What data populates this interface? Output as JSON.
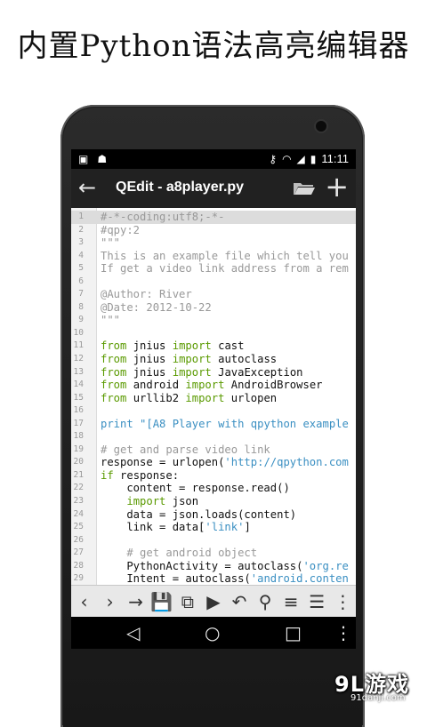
{
  "promo": {
    "title": "内置Python语法高亮编辑器"
  },
  "status_bar": {
    "time": "11:11"
  },
  "action_bar": {
    "title": "QEdit - a8player.py"
  },
  "editor": {
    "lines": [
      {
        "n": "1",
        "html": "<span class='cm'>#-*-coding:utf8;-*-</span>"
      },
      {
        "n": "2",
        "html": "<span class='cm'>#qpy:2</span>"
      },
      {
        "n": "3",
        "html": "<span class='cm'>\"\"\"</span>"
      },
      {
        "n": "4",
        "html": "<span class='cm'>This is an example file which tell you</span>"
      },
      {
        "n": "5",
        "html": "<span class='cm'>If get a video link address from a rem</span>"
      },
      {
        "n": "6",
        "html": ""
      },
      {
        "n": "7",
        "html": "<span class='cm'>@Author: River</span>"
      },
      {
        "n": "8",
        "html": "<span class='cm'>@Date: 2012-10-22</span>"
      },
      {
        "n": "9",
        "html": "<span class='cm'>\"\"\"</span>"
      },
      {
        "n": "10",
        "html": ""
      },
      {
        "n": "11",
        "html": "<span class='kw'>from</span> jnius <span class='kw'>import</span> cast"
      },
      {
        "n": "12",
        "html": "<span class='kw'>from</span> jnius <span class='kw'>import</span> autoclass"
      },
      {
        "n": "13",
        "html": "<span class='kw'>from</span> jnius <span class='kw'>import</span> JavaException"
      },
      {
        "n": "14",
        "html": "<span class='kw'>from</span> android <span class='kw'>import</span> AndroidBrowser"
      },
      {
        "n": "15",
        "html": "<span class='kw'>from</span> urllib2 <span class='kw'>import</span> urlopen"
      },
      {
        "n": "16",
        "html": ""
      },
      {
        "n": "17",
        "html": "<span class='pr'>print</span> <span class='str'>\"[A8 Player with qpython example</span>"
      },
      {
        "n": "18",
        "html": ""
      },
      {
        "n": "19",
        "html": "<span class='cm'># get and parse video link</span>"
      },
      {
        "n": "20",
        "html": "response = urlopen(<span class='str'>'http://qpython.com</span>"
      },
      {
        "n": "21",
        "html": "<span class='kw'>if</span> response:"
      },
      {
        "n": "22",
        "html": "    content = response.read()"
      },
      {
        "n": "23",
        "html": "    <span class='kw'>import</span> json"
      },
      {
        "n": "24",
        "html": "    data = json.loads(content)"
      },
      {
        "n": "25",
        "html": "    link = data[<span class='str'>'link'</span>]"
      },
      {
        "n": "26",
        "html": ""
      },
      {
        "n": "27",
        "html": "    <span class='cm'># get android object</span>"
      },
      {
        "n": "28",
        "html": "    PythonActivity = autoclass(<span class='str'>'org.re</span>"
      },
      {
        "n": "29",
        "html": "    Intent = autoclass(<span class='str'>'android.conten</span>"
      }
    ]
  },
  "toolbar": {
    "items": [
      {
        "name": "undo-nav-left-icon",
        "glyph": "‹"
      },
      {
        "name": "nav-right-icon",
        "glyph": "›"
      },
      {
        "name": "goto-arrow-icon",
        "glyph": "→"
      },
      {
        "name": "save-icon",
        "glyph": "💾"
      },
      {
        "name": "save-as-icon",
        "glyph": "⧉"
      },
      {
        "name": "run-icon",
        "glyph": "▶"
      },
      {
        "name": "undo-icon",
        "glyph": "↶"
      },
      {
        "name": "search-icon",
        "glyph": "⚲"
      },
      {
        "name": "indent-icon",
        "glyph": "≡"
      },
      {
        "name": "snippets-icon",
        "glyph": "☰"
      },
      {
        "name": "more-icon",
        "glyph": "⋮"
      }
    ]
  },
  "watermark": {
    "brand": "9L游戏",
    "site": "91danji.com"
  },
  "colors": {
    "keyword": "#5a9a00",
    "string": "#3a8fc2",
    "comment": "#999999",
    "actionbar": "#212121"
  }
}
